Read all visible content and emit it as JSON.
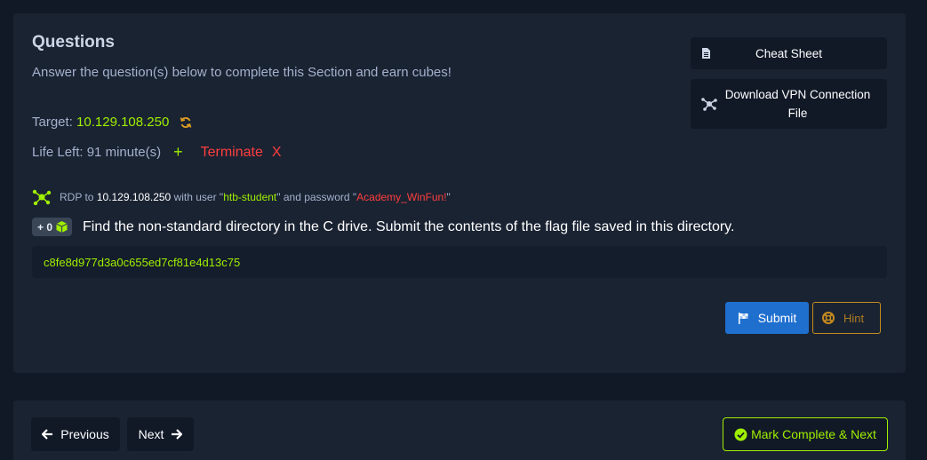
{
  "questions": {
    "title": "Questions",
    "subtitle": "Answer the question(s) below to complete this Section and earn cubes!",
    "target_label": "Target:",
    "target_ip": "10.129.108.250",
    "life_label": "Life Left:",
    "life_value": "91 minute(s)",
    "plus_label": "+",
    "terminate_label": "Terminate",
    "terminate_x": "X"
  },
  "sidebar": {
    "cheat_sheet": "Cheat Sheet",
    "vpn_line1": "Download VPN Connection",
    "vpn_line2": "File"
  },
  "rdp": {
    "prefix": "RDP to",
    "ip": "10.129.108.250",
    "with_user": "with user \"",
    "user": "htb-student",
    "and_password": "\" and password \"",
    "password": "Academy_WinFun!",
    "suffix": "\""
  },
  "question": {
    "cubes": "+ 0",
    "text": "Find the non-standard directory in the C drive. Submit the contents of the flag file saved in this directory.",
    "answer_value": "c8fe8d977d3a0c655ed7cf81e4d13c75"
  },
  "actions": {
    "submit": "Submit",
    "hint": "Hint"
  },
  "footer": {
    "previous": "Previous",
    "next": "Next",
    "mark_complete": "Mark Complete & Next"
  },
  "colors": {
    "accent_green": "#9fef00",
    "danger_red": "#ff3e3e",
    "submit_blue": "#1f6fcf",
    "hint_orange": "#c68b1e"
  }
}
